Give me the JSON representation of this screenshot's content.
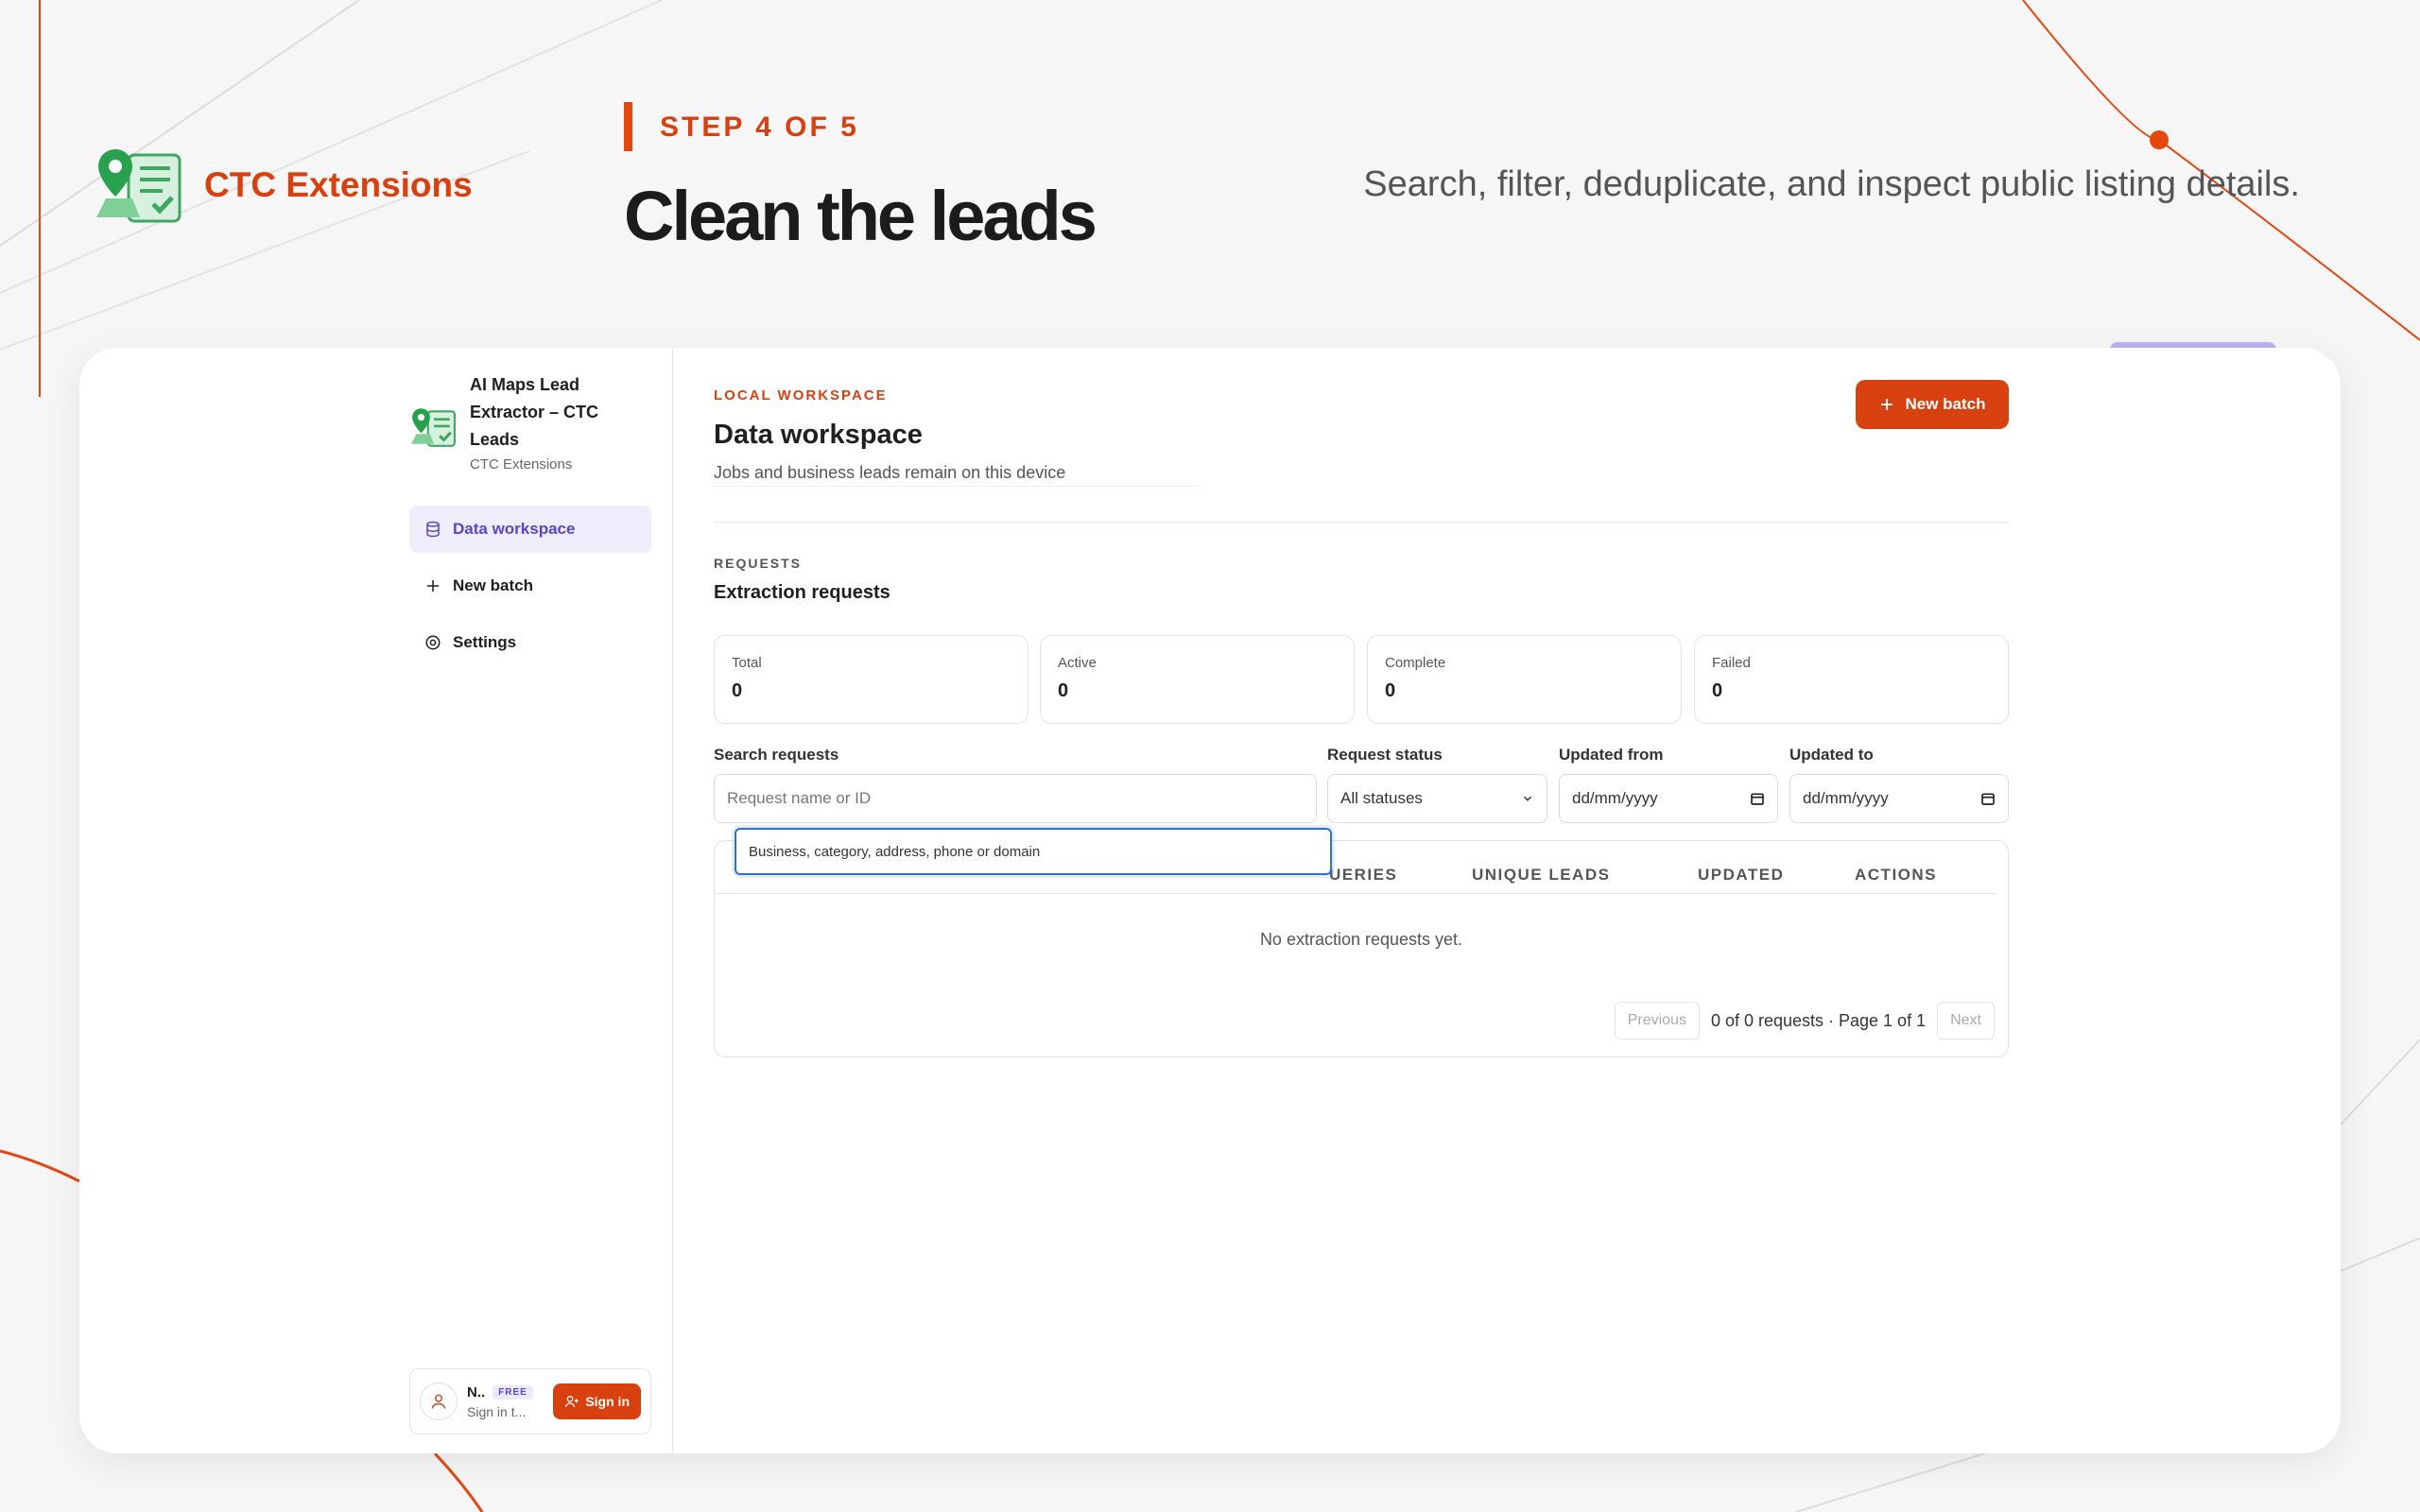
{
  "brand": {
    "name": "CTC Extensions"
  },
  "header": {
    "step": "STEP 4 OF 5",
    "headline": "Clean the leads",
    "tagline": "Search, filter, deduplicate, and inspect public listing details."
  },
  "sidebar": {
    "app_title": "AI Maps Lead Extractor – CTC Leads",
    "app_subtitle": "CTC Extensions",
    "items": [
      {
        "label": "Data workspace",
        "icon": "database-icon",
        "active": true
      },
      {
        "label": "New batch",
        "icon": "plus-icon",
        "active": false
      },
      {
        "label": "Settings",
        "icon": "gear-icon",
        "active": false
      }
    ],
    "account": {
      "name": "N..",
      "badge": "FREE",
      "subtitle": "Sign in t...",
      "signin_label": "Sign in"
    }
  },
  "workspace": {
    "eyebrow": "LOCAL WORKSPACE",
    "title": "Data workspace",
    "description": "Jobs and business leads remain on this device",
    "new_batch_label": "New batch"
  },
  "requests": {
    "eyebrow": "REQUESTS",
    "title": "Extraction requests",
    "stats": [
      {
        "label": "Total",
        "value": "0"
      },
      {
        "label": "Active",
        "value": "0"
      },
      {
        "label": "Complete",
        "value": "0"
      },
      {
        "label": "Failed",
        "value": "0"
      }
    ],
    "filters": {
      "search_label": "Search requests",
      "search_placeholder": "Request name or ID",
      "status_label": "Request status",
      "status_value": "All statuses",
      "from_label": "Updated from",
      "from_value": "dd/mm/yyyy",
      "to_label": "Updated to",
      "to_value": "dd/mm/yyyy"
    },
    "suggestion": "Business, category, address, phone or domain",
    "columns": [
      "UERIES",
      "UNIQUE LEADS",
      "UPDATED",
      "ACTIONS"
    ],
    "empty_text": "No extraction requests yet.",
    "pagination": {
      "prev_label": "Previous",
      "info": "0 of 0 requests · Page 1 of 1",
      "next_label": "Next"
    }
  },
  "colors": {
    "accent": "#d9400f",
    "active_nav": "#5a45c7",
    "focus_ring": "#2f6fd6"
  }
}
